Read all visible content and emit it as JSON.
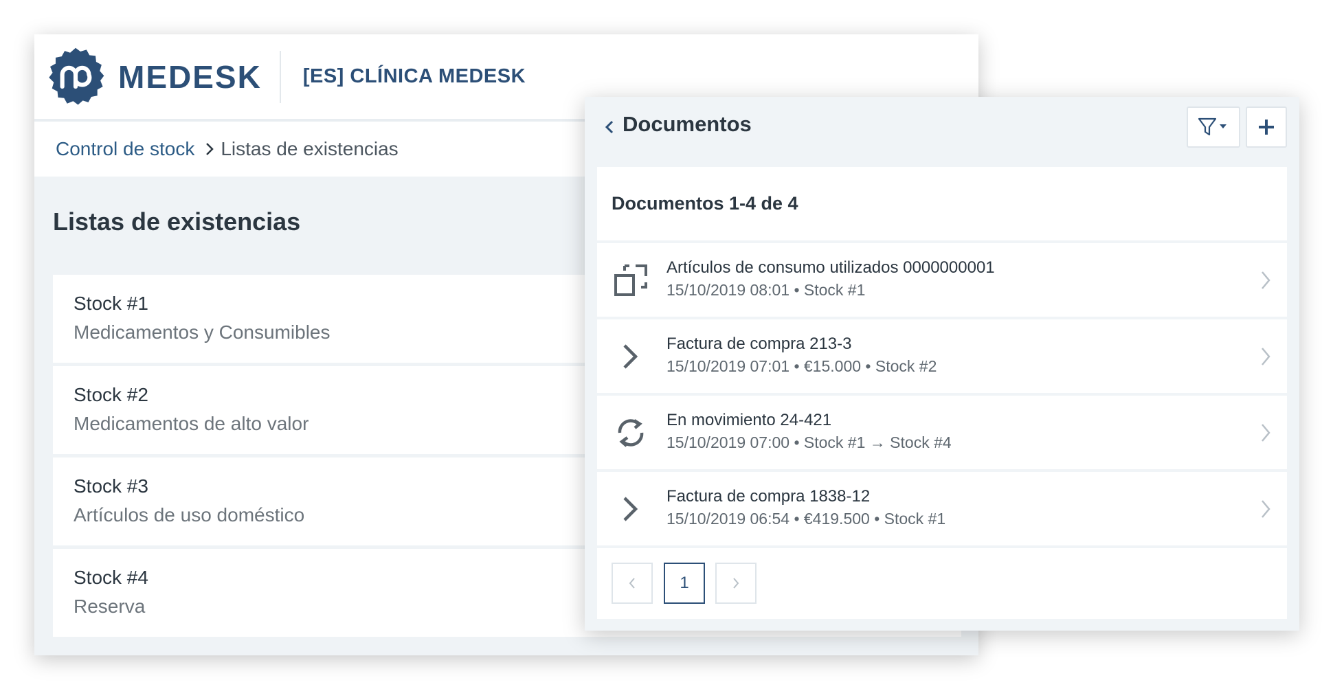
{
  "header": {
    "brand": "MEDESK",
    "clinic": "[ES] CLÍNICA MEDESK"
  },
  "breadcrumb": {
    "parent": "Control de stock",
    "current": "Listas de existencias"
  },
  "page": {
    "title": "Listas de existencias"
  },
  "stocks": [
    {
      "name": "Stock #1",
      "desc": "Medicamentos y Consumibles"
    },
    {
      "name": "Stock #2",
      "desc": "Medicamentos de alto valor"
    },
    {
      "name": "Stock #3",
      "desc": "Artículos de uso doméstico"
    },
    {
      "name": "Stock #4",
      "desc": "Reserva"
    }
  ],
  "panel": {
    "title": "Documentos",
    "count_label": "Documentos 1-4 de 4",
    "documents": [
      {
        "icon": "consumption-icon",
        "title": "Artículos de consumo utilizados 0000000001",
        "meta": "15/10/2019 08:01 • Stock #1"
      },
      {
        "icon": "incoming-arrow-icon",
        "title": "Factura de compra 213-3",
        "meta": "15/10/2019 07:01 • €15.000 • Stock #2"
      },
      {
        "icon": "transfer-cycle-icon",
        "title": "En movimiento 24-421",
        "meta": "15/10/2019 07:00 • Stock #1 → Stock #4"
      },
      {
        "icon": "incoming-arrow-icon",
        "title": "Factura de compra 1838-12",
        "meta": "15/10/2019 06:54 • €419.500 • Stock #1"
      }
    ],
    "pagination": {
      "prev": "<",
      "current": "1",
      "next": ">"
    }
  },
  "colors": {
    "brand": "#2c4f77",
    "background": "#eff3f6"
  }
}
